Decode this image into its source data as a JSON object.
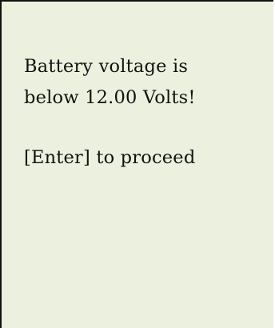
{
  "screen": {
    "message_line_1": "Battery voltage is",
    "message_line_2": "below 12.00 Volts!",
    "prompt_line": "[Enter] to proceed",
    "background_color": "#ecf1df",
    "text_color": "#111111"
  }
}
